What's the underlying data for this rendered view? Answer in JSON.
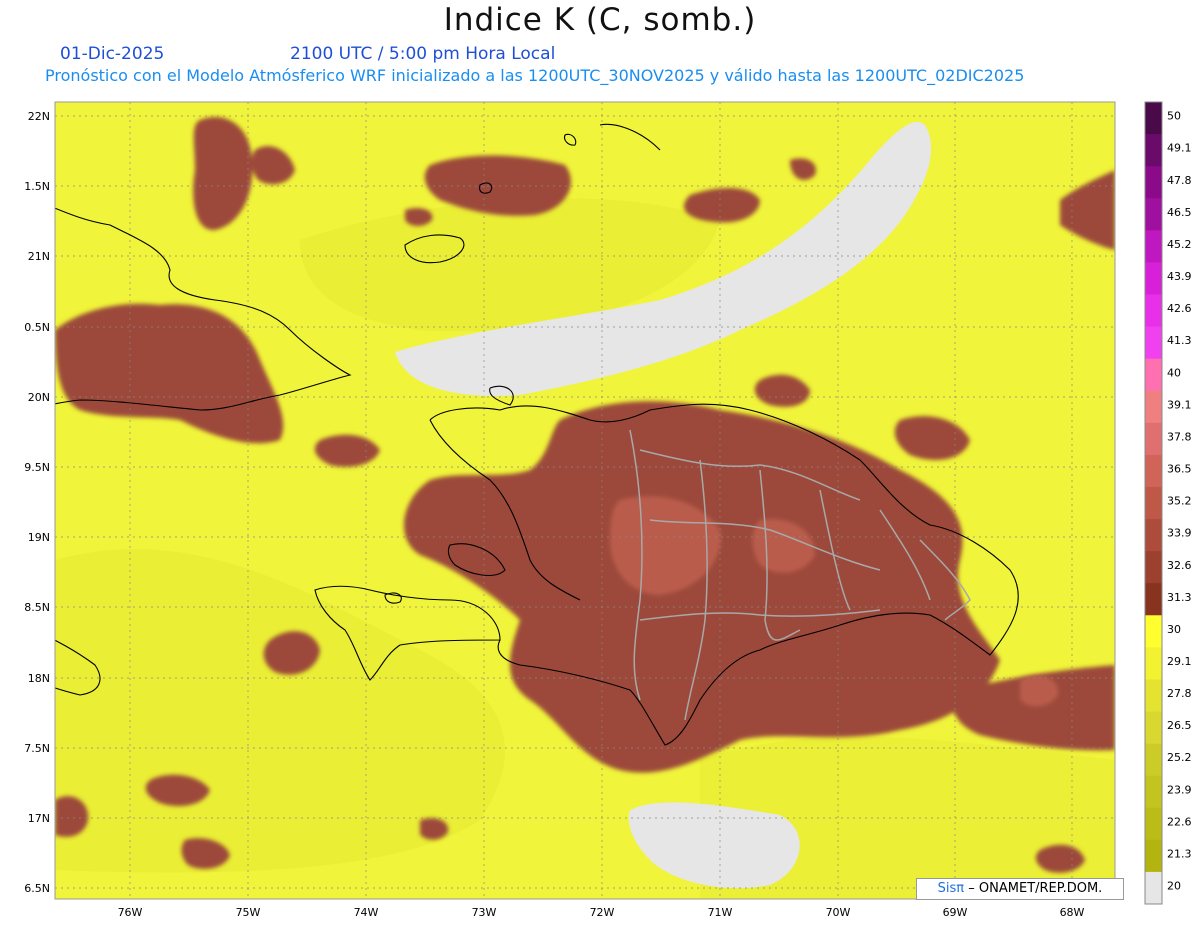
{
  "header": {
    "title": "Indice K (C, somb.)",
    "date": "01-Dic-2025",
    "time_info": "2100 UTC / 5:00 pm Hora Local",
    "subtitle": "Pronóstico con el Modelo Atmósferico WRF inicializado a las 1200UTC_30NOV2025 y válido hasta las  1200UTC_02DIC2025"
  },
  "axes": {
    "lat_labels": [
      "22N",
      "1.5N",
      "21N",
      "0.5N",
      "20N",
      "9.5N",
      "19N",
      "8.5N",
      "18N",
      "7.5N",
      "17N",
      "6.5N"
    ],
    "lon_labels": [
      "76W",
      "75W",
      "74W",
      "73W",
      "72W",
      "71W",
      "70W",
      "69W",
      "68W"
    ]
  },
  "colorbar": {
    "labels": [
      "50",
      "49.1",
      "47.8",
      "46.5",
      "45.2",
      "43.9",
      "42.6",
      "41.3",
      "40",
      "39.1",
      "37.8",
      "36.5",
      "35.2",
      "33.9",
      "32.6",
      "31.3",
      "30",
      "29.1",
      "27.8",
      "26.5",
      "25.2",
      "23.9",
      "22.6",
      "21.3",
      "20"
    ],
    "colors": [
      "#4a0a4a",
      "#6a0a6a",
      "#8a0a8a",
      "#a010a0",
      "#c018c0",
      "#d820d8",
      "#e830e8",
      "#f040f0",
      "#ff70b0",
      "#f08080",
      "#e07070",
      "#d06458",
      "#c05848",
      "#ae4c3c",
      "#9c4030",
      "#883220",
      "#ffff30",
      "#f2f230",
      "#e4e430",
      "#d8d830",
      "#cccc28",
      "#c4c420",
      "#bcbc18",
      "#b4b410",
      "#e6e6e6"
    ]
  },
  "credit": {
    "brand": "Sisπ",
    "text": "– ONAMET/REP.DOM."
  },
  "map_colors": {
    "background_field": "#f0f43a",
    "light_field": "#e8ec30",
    "high_field": "#9c4a3a",
    "very_high_field": "#c06050",
    "missing": "#e6e6e6",
    "coastline": "#000000",
    "province_lines": "#a8a8a8"
  }
}
